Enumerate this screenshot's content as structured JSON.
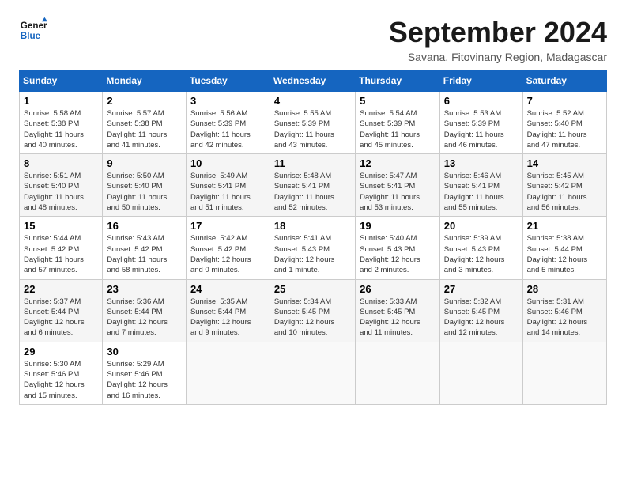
{
  "logo": {
    "line1": "General",
    "line2": "Blue"
  },
  "title": "September 2024",
  "subtitle": "Savana, Fitovinany Region, Madagascar",
  "days_of_week": [
    "Sunday",
    "Monday",
    "Tuesday",
    "Wednesday",
    "Thursday",
    "Friday",
    "Saturday"
  ],
  "weeks": [
    [
      {
        "day": 1,
        "info": "Sunrise: 5:58 AM\nSunset: 5:38 PM\nDaylight: 11 hours\nand 40 minutes."
      },
      {
        "day": 2,
        "info": "Sunrise: 5:57 AM\nSunset: 5:38 PM\nDaylight: 11 hours\nand 41 minutes."
      },
      {
        "day": 3,
        "info": "Sunrise: 5:56 AM\nSunset: 5:39 PM\nDaylight: 11 hours\nand 42 minutes."
      },
      {
        "day": 4,
        "info": "Sunrise: 5:55 AM\nSunset: 5:39 PM\nDaylight: 11 hours\nand 43 minutes."
      },
      {
        "day": 5,
        "info": "Sunrise: 5:54 AM\nSunset: 5:39 PM\nDaylight: 11 hours\nand 45 minutes."
      },
      {
        "day": 6,
        "info": "Sunrise: 5:53 AM\nSunset: 5:39 PM\nDaylight: 11 hours\nand 46 minutes."
      },
      {
        "day": 7,
        "info": "Sunrise: 5:52 AM\nSunset: 5:40 PM\nDaylight: 11 hours\nand 47 minutes."
      }
    ],
    [
      {
        "day": 8,
        "info": "Sunrise: 5:51 AM\nSunset: 5:40 PM\nDaylight: 11 hours\nand 48 minutes."
      },
      {
        "day": 9,
        "info": "Sunrise: 5:50 AM\nSunset: 5:40 PM\nDaylight: 11 hours\nand 50 minutes."
      },
      {
        "day": 10,
        "info": "Sunrise: 5:49 AM\nSunset: 5:41 PM\nDaylight: 11 hours\nand 51 minutes."
      },
      {
        "day": 11,
        "info": "Sunrise: 5:48 AM\nSunset: 5:41 PM\nDaylight: 11 hours\nand 52 minutes."
      },
      {
        "day": 12,
        "info": "Sunrise: 5:47 AM\nSunset: 5:41 PM\nDaylight: 11 hours\nand 53 minutes."
      },
      {
        "day": 13,
        "info": "Sunrise: 5:46 AM\nSunset: 5:41 PM\nDaylight: 11 hours\nand 55 minutes."
      },
      {
        "day": 14,
        "info": "Sunrise: 5:45 AM\nSunset: 5:42 PM\nDaylight: 11 hours\nand 56 minutes."
      }
    ],
    [
      {
        "day": 15,
        "info": "Sunrise: 5:44 AM\nSunset: 5:42 PM\nDaylight: 11 hours\nand 57 minutes."
      },
      {
        "day": 16,
        "info": "Sunrise: 5:43 AM\nSunset: 5:42 PM\nDaylight: 11 hours\nand 58 minutes."
      },
      {
        "day": 17,
        "info": "Sunrise: 5:42 AM\nSunset: 5:42 PM\nDaylight: 12 hours\nand 0 minutes."
      },
      {
        "day": 18,
        "info": "Sunrise: 5:41 AM\nSunset: 5:43 PM\nDaylight: 12 hours\nand 1 minute."
      },
      {
        "day": 19,
        "info": "Sunrise: 5:40 AM\nSunset: 5:43 PM\nDaylight: 12 hours\nand 2 minutes."
      },
      {
        "day": 20,
        "info": "Sunrise: 5:39 AM\nSunset: 5:43 PM\nDaylight: 12 hours\nand 3 minutes."
      },
      {
        "day": 21,
        "info": "Sunrise: 5:38 AM\nSunset: 5:44 PM\nDaylight: 12 hours\nand 5 minutes."
      }
    ],
    [
      {
        "day": 22,
        "info": "Sunrise: 5:37 AM\nSunset: 5:44 PM\nDaylight: 12 hours\nand 6 minutes."
      },
      {
        "day": 23,
        "info": "Sunrise: 5:36 AM\nSunset: 5:44 PM\nDaylight: 12 hours\nand 7 minutes."
      },
      {
        "day": 24,
        "info": "Sunrise: 5:35 AM\nSunset: 5:44 PM\nDaylight: 12 hours\nand 9 minutes."
      },
      {
        "day": 25,
        "info": "Sunrise: 5:34 AM\nSunset: 5:45 PM\nDaylight: 12 hours\nand 10 minutes."
      },
      {
        "day": 26,
        "info": "Sunrise: 5:33 AM\nSunset: 5:45 PM\nDaylight: 12 hours\nand 11 minutes."
      },
      {
        "day": 27,
        "info": "Sunrise: 5:32 AM\nSunset: 5:45 PM\nDaylight: 12 hours\nand 12 minutes."
      },
      {
        "day": 28,
        "info": "Sunrise: 5:31 AM\nSunset: 5:46 PM\nDaylight: 12 hours\nand 14 minutes."
      }
    ],
    [
      {
        "day": 29,
        "info": "Sunrise: 5:30 AM\nSunset: 5:46 PM\nDaylight: 12 hours\nand 15 minutes."
      },
      {
        "day": 30,
        "info": "Sunrise: 5:29 AM\nSunset: 5:46 PM\nDaylight: 12 hours\nand 16 minutes."
      },
      null,
      null,
      null,
      null,
      null
    ]
  ]
}
